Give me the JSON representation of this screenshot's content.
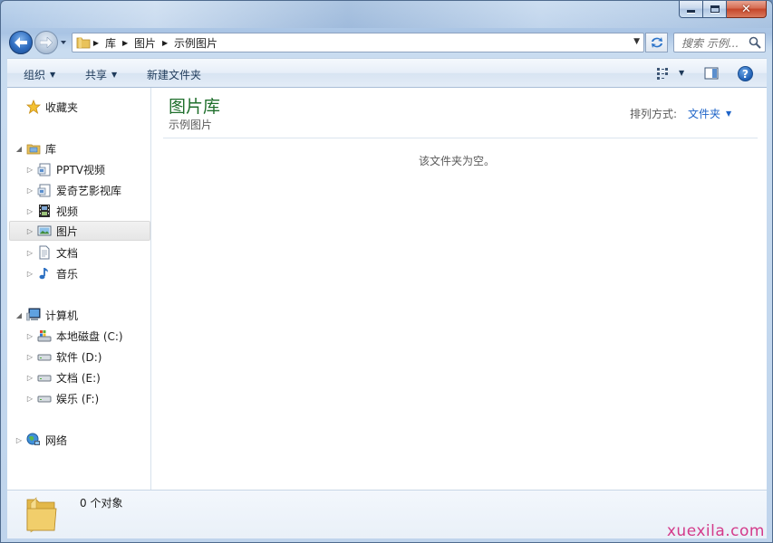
{
  "window": {
    "caption": {
      "minimize": "minimize",
      "maximize": "maximize",
      "close": "close"
    }
  },
  "address": {
    "crumbs": [
      "库",
      "图片",
      "示例图片"
    ],
    "search_placeholder": "搜索 示例..."
  },
  "toolbar": {
    "organize": "组织",
    "share": "共享",
    "new_folder": "新建文件夹"
  },
  "nav": {
    "favorites": "收藏夹",
    "libraries": "库",
    "library_items": [
      "PPTV视频",
      "爱奇艺影视库",
      "视频",
      "图片",
      "文档",
      "音乐"
    ],
    "computer": "计算机",
    "drives": [
      "本地磁盘 (C:)",
      "软件 (D:)",
      "文档 (E:)",
      "娱乐 (F:)"
    ],
    "network": "网络"
  },
  "main": {
    "title": "图片库",
    "subtitle": "示例图片",
    "sort_label": "排列方式:",
    "sort_value": "文件夹",
    "empty_message": "该文件夹为空。"
  },
  "details": {
    "count_text": "0 个对象"
  },
  "watermark": "xuexila.com",
  "colors": {
    "library_title": "#1e6e2b",
    "link": "#1e64c8",
    "watermark": "#d43a8a"
  }
}
